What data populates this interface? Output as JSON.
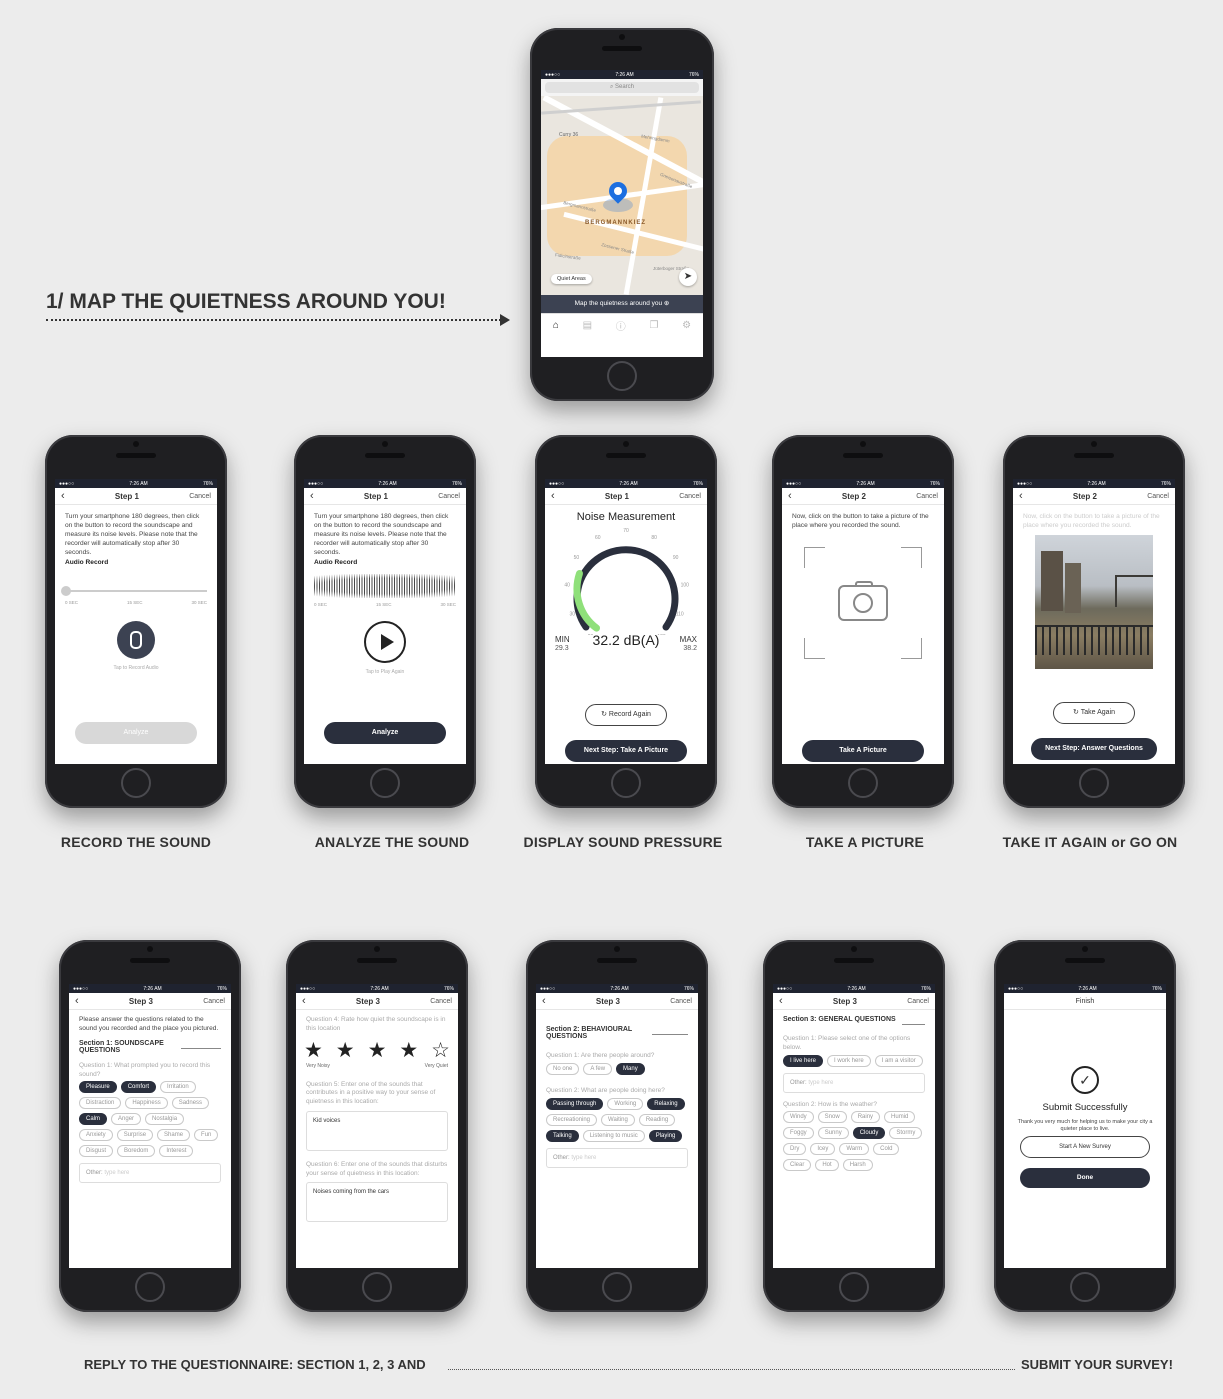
{
  "headline": "1/ MAP THE QUIETNESS AROUND YOU!",
  "status": {
    "time": "7:26 AM",
    "battery": "76%"
  },
  "map": {
    "search_placeholder": "Search",
    "labels": [
      "Curry 36",
      "BERGMANNKIEZ",
      "Bergmannstraße",
      "Fidicinstraße",
      "Zossener Straße",
      "Gneisenaustraße",
      "Mehringdamm",
      "Jüterboger Straße"
    ],
    "quiet_areas": "Quiet Areas",
    "banner": "Map the quietness around you",
    "tabs": [
      "home-icon",
      "inbox-icon",
      "info-icon",
      "chat-icon",
      "settings-icon"
    ]
  },
  "row1": [
    {
      "caption": "RECORD THE SOUND"
    },
    {
      "caption": "ANALYZE THE SOUND"
    },
    {
      "caption": "DISPLAY SOUND PRESSURE"
    },
    {
      "caption": "TAKE A PICTURE"
    },
    {
      "caption": "TAKE IT AGAIN or GO ON"
    }
  ],
  "nav": {
    "step1": "Step 1",
    "step2": "Step 2",
    "step3": "Step 3",
    "cancel": "Cancel",
    "finish": "Finish"
  },
  "record": {
    "instructions": "Turn your smartphone 180 degrees, then click on the button to record the soundscape and measure its noise levels. Please note that the recorder will automatically stop after 30 seconds.",
    "audio_record": "Audio Record",
    "ticks": [
      "0 SEC",
      "15 SEC",
      "30 SEC"
    ],
    "tap_record": "Tap to Record Audio",
    "tap_play": "Tap to Play Again",
    "analyze": "Analyze"
  },
  "noise": {
    "title": "Noise Measurement",
    "min_label": "MIN",
    "min_value": "29.3",
    "max_label": "MAX",
    "max_value": "38.2",
    "value": "32.2 dB(A)",
    "gauge_level": 0.25,
    "scale": [
      "20",
      "30",
      "40",
      "50",
      "60",
      "70",
      "80",
      "90",
      "100",
      "110",
      "120"
    ],
    "record_again": "Record Again",
    "next": "Next Step: Take A Picture"
  },
  "picture": {
    "instructions": "Now, click on the button to take a picture of the place where you recorded the sound.",
    "take": "Take A Picture",
    "take_again": "Take Again",
    "next": "Next Step: Answer Questions"
  },
  "survey1": {
    "intro": "Please answer the questions related to the sound you recorded and the place you pictured.",
    "section": "Section 1: SOUNDSCAPE QUESTIONS",
    "q1": "Question 1: What prompted you to record this sound?",
    "chips": [
      {
        "label": "Pleasure",
        "on": true
      },
      {
        "label": "Comfort",
        "on": true
      },
      {
        "label": "Irritation",
        "on": false
      },
      {
        "label": "Distraction",
        "on": false
      },
      {
        "label": "Happiness",
        "on": false
      },
      {
        "label": "Sadness",
        "on": false
      },
      {
        "label": "Calm",
        "on": true
      },
      {
        "label": "Anger",
        "on": false
      },
      {
        "label": "Nostalgia",
        "on": false
      },
      {
        "label": "Anxiety",
        "on": false
      },
      {
        "label": "Surprise",
        "on": false
      },
      {
        "label": "Shame",
        "on": false
      },
      {
        "label": "Fun",
        "on": false
      },
      {
        "label": "Disgust",
        "on": false
      },
      {
        "label": "Boredom",
        "on": false
      },
      {
        "label": "Interest",
        "on": false
      }
    ],
    "other": "Other:",
    "other_ph": "type here"
  },
  "survey1b": {
    "q4": "Question 4: Rate how quiet the soundscape is in this location",
    "rating": 4,
    "very_noisy": "Very Noisy",
    "very_quiet": "Very Quiet",
    "q5": "Question 5: Enter one of the sounds that contributes in a positive way to your sense of quietness in this location:",
    "a5": "Kid voices",
    "q6": "Question 6: Enter one of the sounds that disturbs your sense of quietness in this location:",
    "a6": "Noises coming from the cars"
  },
  "survey2": {
    "section": "Section 2: BEHAVIOURAL QUESTIONS",
    "q1": "Question 1: Are there people around?",
    "q1_chips": [
      {
        "label": "No one",
        "on": false
      },
      {
        "label": "A few",
        "on": false
      },
      {
        "label": "Many",
        "on": true
      }
    ],
    "q2": "Question 2: What are people doing here?",
    "q2_chips": [
      {
        "label": "Passing through",
        "on": true
      },
      {
        "label": "Working",
        "on": false
      },
      {
        "label": "Relaxing",
        "on": true
      },
      {
        "label": "Recreationing",
        "on": false
      },
      {
        "label": "Waiting",
        "on": false
      },
      {
        "label": "Reading",
        "on": false
      },
      {
        "label": "Talking",
        "on": true
      },
      {
        "label": "Listening to music",
        "on": false
      },
      {
        "label": "Playing",
        "on": true
      }
    ],
    "other": "Other:",
    "other_ph": "type here"
  },
  "survey3": {
    "section": "Section 3: GENERAL QUESTIONS",
    "q1": "Question 1: Please select one of the options below.",
    "q1_chips": [
      {
        "label": "I live here",
        "on": true
      },
      {
        "label": "I work here",
        "on": false
      },
      {
        "label": "I am a visitor",
        "on": false
      }
    ],
    "other": "Other:",
    "other_ph": "type here",
    "q2": "Question 2: How is the weather?",
    "q2_chips": [
      {
        "label": "Windy",
        "on": false
      },
      {
        "label": "Snow",
        "on": false
      },
      {
        "label": "Rainy",
        "on": false
      },
      {
        "label": "Humid",
        "on": false
      },
      {
        "label": "Foggy",
        "on": false
      },
      {
        "label": "Sunny",
        "on": false
      },
      {
        "label": "Cloudy",
        "on": true
      },
      {
        "label": "Stormy",
        "on": false
      },
      {
        "label": "Dry",
        "on": false
      },
      {
        "label": "Icey",
        "on": false
      },
      {
        "label": "Warm",
        "on": false
      },
      {
        "label": "Cold",
        "on": false
      },
      {
        "label": "Clear",
        "on": false
      },
      {
        "label": "Hot",
        "on": false
      },
      {
        "label": "Harsh",
        "on": false
      }
    ]
  },
  "finish": {
    "title": "Submit Successfully",
    "thanks": "Thank you very much for helping us to make your city a quieter place to live.",
    "new_survey": "Start A New Survey",
    "done": "Done"
  },
  "footer": {
    "left": "REPLY TO THE QUESTIONNAIRE: SECTION 1, 2, 3 AND",
    "right": "SUBMIT YOUR SURVEY!"
  }
}
